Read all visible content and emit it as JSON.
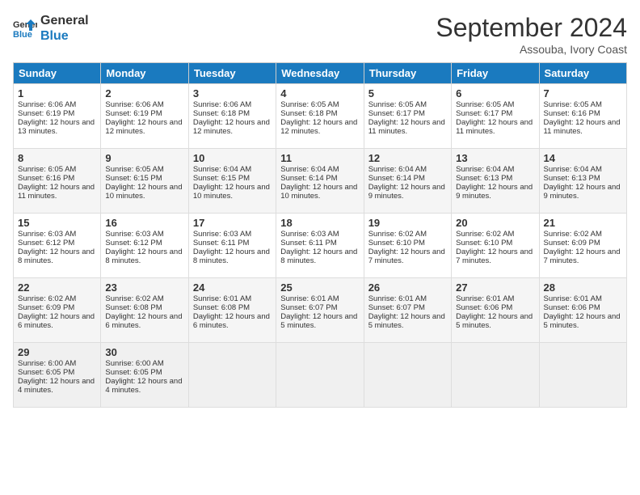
{
  "logo": {
    "line1": "General",
    "line2": "Blue"
  },
  "title": "September 2024",
  "location": "Assouba, Ivory Coast",
  "headers": [
    "Sunday",
    "Monday",
    "Tuesday",
    "Wednesday",
    "Thursday",
    "Friday",
    "Saturday"
  ],
  "weeks": [
    [
      {
        "day": "1",
        "sunrise": "6:06 AM",
        "sunset": "6:19 PM",
        "daylight": "12 hours and 13 minutes."
      },
      {
        "day": "2",
        "sunrise": "6:06 AM",
        "sunset": "6:19 PM",
        "daylight": "12 hours and 12 minutes."
      },
      {
        "day": "3",
        "sunrise": "6:06 AM",
        "sunset": "6:18 PM",
        "daylight": "12 hours and 12 minutes."
      },
      {
        "day": "4",
        "sunrise": "6:05 AM",
        "sunset": "6:18 PM",
        "daylight": "12 hours and 12 minutes."
      },
      {
        "day": "5",
        "sunrise": "6:05 AM",
        "sunset": "6:17 PM",
        "daylight": "12 hours and 11 minutes."
      },
      {
        "day": "6",
        "sunrise": "6:05 AM",
        "sunset": "6:17 PM",
        "daylight": "12 hours and 11 minutes."
      },
      {
        "day": "7",
        "sunrise": "6:05 AM",
        "sunset": "6:16 PM",
        "daylight": "12 hours and 11 minutes."
      }
    ],
    [
      {
        "day": "8",
        "sunrise": "6:05 AM",
        "sunset": "6:16 PM",
        "daylight": "12 hours and 11 minutes."
      },
      {
        "day": "9",
        "sunrise": "6:05 AM",
        "sunset": "6:15 PM",
        "daylight": "12 hours and 10 minutes."
      },
      {
        "day": "10",
        "sunrise": "6:04 AM",
        "sunset": "6:15 PM",
        "daylight": "12 hours and 10 minutes."
      },
      {
        "day": "11",
        "sunrise": "6:04 AM",
        "sunset": "6:14 PM",
        "daylight": "12 hours and 10 minutes."
      },
      {
        "day": "12",
        "sunrise": "6:04 AM",
        "sunset": "6:14 PM",
        "daylight": "12 hours and 9 minutes."
      },
      {
        "day": "13",
        "sunrise": "6:04 AM",
        "sunset": "6:13 PM",
        "daylight": "12 hours and 9 minutes."
      },
      {
        "day": "14",
        "sunrise": "6:04 AM",
        "sunset": "6:13 PM",
        "daylight": "12 hours and 9 minutes."
      }
    ],
    [
      {
        "day": "15",
        "sunrise": "6:03 AM",
        "sunset": "6:12 PM",
        "daylight": "12 hours and 8 minutes."
      },
      {
        "day": "16",
        "sunrise": "6:03 AM",
        "sunset": "6:12 PM",
        "daylight": "12 hours and 8 minutes."
      },
      {
        "day": "17",
        "sunrise": "6:03 AM",
        "sunset": "6:11 PM",
        "daylight": "12 hours and 8 minutes."
      },
      {
        "day": "18",
        "sunrise": "6:03 AM",
        "sunset": "6:11 PM",
        "daylight": "12 hours and 8 minutes."
      },
      {
        "day": "19",
        "sunrise": "6:02 AM",
        "sunset": "6:10 PM",
        "daylight": "12 hours and 7 minutes."
      },
      {
        "day": "20",
        "sunrise": "6:02 AM",
        "sunset": "6:10 PM",
        "daylight": "12 hours and 7 minutes."
      },
      {
        "day": "21",
        "sunrise": "6:02 AM",
        "sunset": "6:09 PM",
        "daylight": "12 hours and 7 minutes."
      }
    ],
    [
      {
        "day": "22",
        "sunrise": "6:02 AM",
        "sunset": "6:09 PM",
        "daylight": "12 hours and 6 minutes."
      },
      {
        "day": "23",
        "sunrise": "6:02 AM",
        "sunset": "6:08 PM",
        "daylight": "12 hours and 6 minutes."
      },
      {
        "day": "24",
        "sunrise": "6:01 AM",
        "sunset": "6:08 PM",
        "daylight": "12 hours and 6 minutes."
      },
      {
        "day": "25",
        "sunrise": "6:01 AM",
        "sunset": "6:07 PM",
        "daylight": "12 hours and 5 minutes."
      },
      {
        "day": "26",
        "sunrise": "6:01 AM",
        "sunset": "6:07 PM",
        "daylight": "12 hours and 5 minutes."
      },
      {
        "day": "27",
        "sunrise": "6:01 AM",
        "sunset": "6:06 PM",
        "daylight": "12 hours and 5 minutes."
      },
      {
        "day": "28",
        "sunrise": "6:01 AM",
        "sunset": "6:06 PM",
        "daylight": "12 hours and 5 minutes."
      }
    ],
    [
      {
        "day": "29",
        "sunrise": "6:00 AM",
        "sunset": "6:05 PM",
        "daylight": "12 hours and 4 minutes."
      },
      {
        "day": "30",
        "sunrise": "6:00 AM",
        "sunset": "6:05 PM",
        "daylight": "12 hours and 4 minutes."
      },
      null,
      null,
      null,
      null,
      null
    ]
  ]
}
